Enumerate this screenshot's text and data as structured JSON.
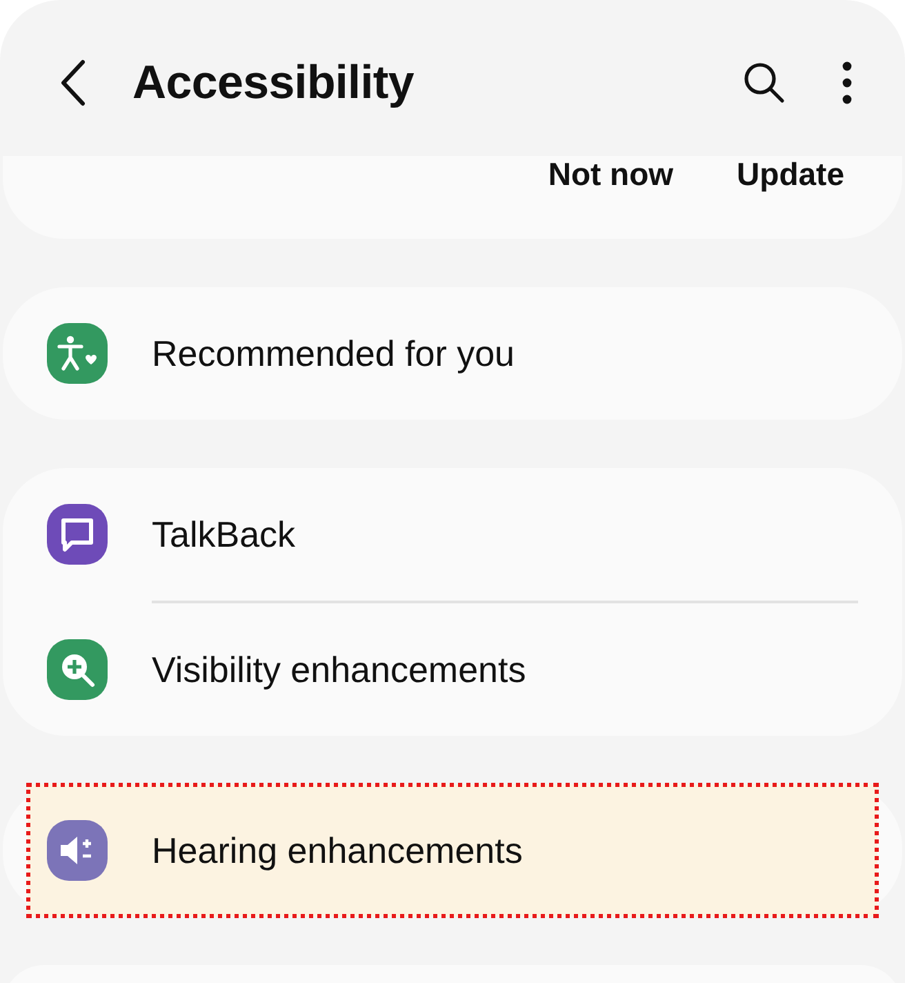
{
  "header": {
    "title": "Accessibility"
  },
  "banner": {
    "buttons": [
      "Not now",
      "Update"
    ]
  },
  "groups": [
    {
      "items": [
        {
          "label": "Recommended for you",
          "kind": "person",
          "color": "#339960",
          "highlighted": false
        }
      ]
    },
    {
      "items": [
        {
          "label": "TalkBack",
          "kind": "chat",
          "color": "#6e4bb8",
          "highlighted": false
        },
        {
          "label": "Visibility enhancements",
          "kind": "zoom",
          "color": "#339960",
          "highlighted": false
        }
      ]
    },
    {
      "items": [
        {
          "label": "Hearing enhancements",
          "kind": "speaker",
          "color": "#7c74b8",
          "highlighted": true
        }
      ]
    }
  ]
}
